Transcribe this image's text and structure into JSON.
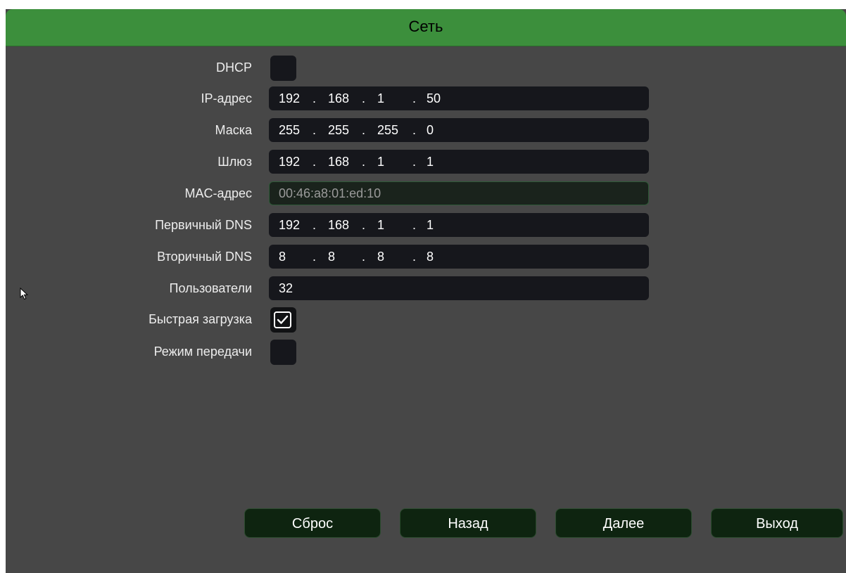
{
  "window": {
    "title": "Сеть"
  },
  "form": {
    "dhcp": {
      "label": "DHCP",
      "checked": false
    },
    "ip_address": {
      "label": "IP-адрес",
      "octets": [
        "192",
        "168",
        "1",
        "50"
      ]
    },
    "mask": {
      "label": "Маска",
      "octets": [
        "255",
        "255",
        "255",
        "0"
      ]
    },
    "gateway": {
      "label": "Шлюз",
      "octets": [
        "192",
        "168",
        "1",
        "1"
      ]
    },
    "mac_address": {
      "label": "MAC-адрес",
      "value": "00:46:a8:01:ed:10"
    },
    "primary_dns": {
      "label": "Первичный DNS",
      "octets": [
        "192",
        "168",
        "1",
        "1"
      ]
    },
    "secondary_dns": {
      "label": "Вторичный DNS",
      "octets": [
        "8",
        "8",
        "8",
        "8"
      ]
    },
    "users": {
      "label": "Пользователи",
      "value": "32"
    },
    "fast_boot": {
      "label": "Быстрая загрузка",
      "checked": true
    },
    "transfer_mode": {
      "label": "Режим передачи",
      "checked": false
    }
  },
  "buttons": {
    "reset": "Сброс",
    "back": "Назад",
    "next": "Далее",
    "exit": "Выход"
  },
  "icons": {
    "check": "check-icon",
    "cursor": "mouse-pointer-icon"
  },
  "colors": {
    "title_bar": "#3c8f3c",
    "panel_background": "#474747",
    "field_background": "#16171c",
    "button_background": "#0e2410"
  }
}
